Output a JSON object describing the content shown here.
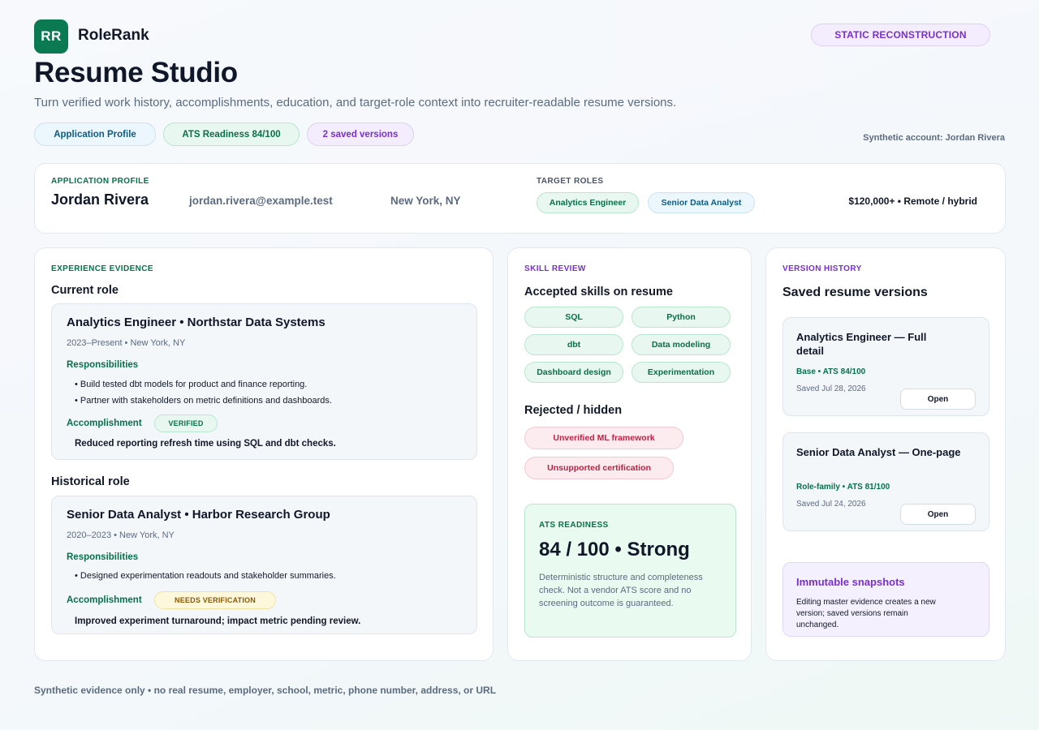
{
  "header": {
    "logo_text": "RR",
    "brand": "RoleRank",
    "badge": "STATIC RECONSTRUCTION",
    "title": "Resume Studio",
    "subtitle": "Turn verified work history, accomplishments, education, and target-role context into recruiter-readable resume versions.",
    "pills": {
      "profile": "Application Profile",
      "ats": "ATS Readiness 84/100",
      "versions": "2 saved versions"
    },
    "account": "Synthetic account: Jordan Rivera"
  },
  "profile": {
    "eyebrow": "APPLICATION PROFILE",
    "name": "Jordan Rivera",
    "email": "jordan.rivera@example.test",
    "location": "New York, NY",
    "target_label": "TARGET ROLES",
    "target_roles": [
      "Analytics Engineer",
      "Senior Data Analyst"
    ],
    "compensation": "$120,000+ • Remote / hybrid"
  },
  "experience": {
    "eyebrow": "EXPERIENCE EVIDENCE",
    "current_heading": "Current role",
    "current": {
      "title": "Analytics Engineer • Northstar Data Systems",
      "meta": "2023–Present • New York, NY",
      "resp_label": "Responsibilities",
      "bullets": [
        "• Build tested dbt models for product and finance reporting.",
        "• Partner with stakeholders on metric definitions and dashboards."
      ],
      "accomp_label": "Accomplishment",
      "status": "VERIFIED",
      "accomplishment": "Reduced reporting refresh time using SQL and dbt checks."
    },
    "historical_heading": "Historical role",
    "historical": {
      "title": "Senior Data Analyst • Harbor Research Group",
      "meta": "2020–2023 • New York, NY",
      "resp_label": "Responsibilities",
      "bullets": [
        "• Designed experimentation readouts and stakeholder summaries."
      ],
      "accomp_label": "Accomplishment",
      "status": "NEEDS VERIFICATION",
      "accomplishment": "Improved experiment turnaround; impact metric pending review."
    }
  },
  "skills": {
    "eyebrow": "SKILL REVIEW",
    "accepted_heading": "Accepted skills on resume",
    "accepted": [
      "SQL",
      "Python",
      "dbt",
      "Data modeling",
      "Dashboard design",
      "Experimentation"
    ],
    "rejected_heading": "Rejected / hidden",
    "rejected": [
      "Unverified ML framework",
      "Unsupported certification"
    ],
    "ats": {
      "eyebrow": "ATS READINESS",
      "score": "84 / 100 • Strong",
      "description": "Deterministic structure and completeness check. Not a vendor ATS score and no screening outcome is guaranteed."
    }
  },
  "versions": {
    "eyebrow": "VERSION HISTORY",
    "heading": "Saved resume versions",
    "items": [
      {
        "title": "Analytics Engineer — Full detail",
        "meta": "Base • ATS 84/100",
        "date": "Saved Jul 28, 2026",
        "button": "Open"
      },
      {
        "title": "Senior Data Analyst — One-page",
        "meta": "Role-family • ATS 81/100",
        "date": "Saved Jul 24, 2026",
        "button": "Open"
      }
    ],
    "snapshot": {
      "title": "Immutable snapshots",
      "text": "Editing master evidence creates a new version; saved versions remain unchanged."
    }
  },
  "footer": "Synthetic evidence only • no real resume, employer, school, metric, phone number, address, or URL"
}
